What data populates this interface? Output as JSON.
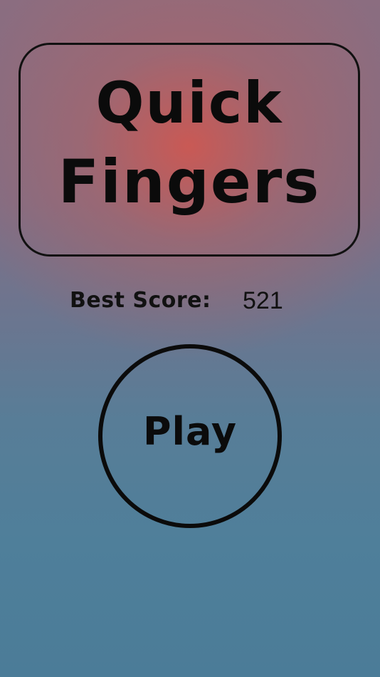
{
  "title": {
    "line1": "Quick",
    "line2": "Fingers"
  },
  "best_score": {
    "label": "Best Score:",
    "value": "521"
  },
  "play": {
    "label": "Play"
  },
  "colors": {
    "top_glow": "#cd5852",
    "background_top": "#8b6d80",
    "background_bottom": "#4b7c98",
    "outline": "#0b0b0b"
  }
}
